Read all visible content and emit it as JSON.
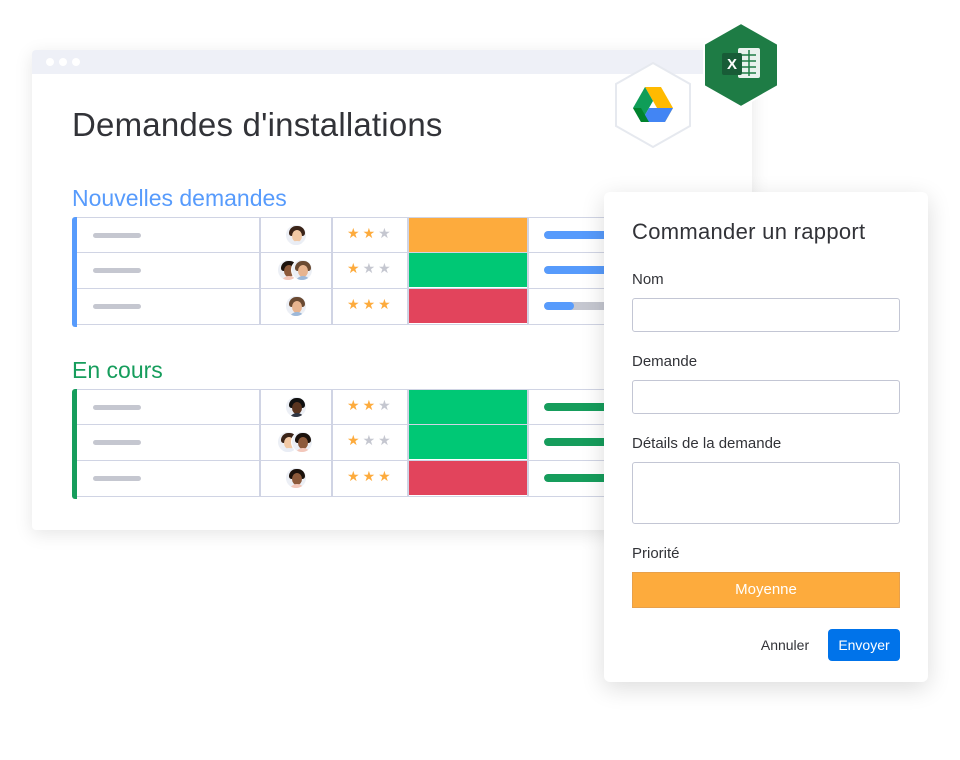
{
  "board": {
    "title": "Demandes d'installations",
    "groups": [
      {
        "title": "Nouvelles demandes",
        "color": "#579bfc",
        "rows": [
          {
            "people": 1,
            "rating": 2,
            "status_color": "#fdab3d",
            "progress": 0.75
          },
          {
            "people": 2,
            "rating": 1,
            "status_color": "#00c875",
            "progress": 0.6
          },
          {
            "people": 1,
            "rating": 3,
            "status_color": "#e2445c",
            "progress": 0.25
          }
        ]
      },
      {
        "title": "En cours",
        "color": "#169d5c",
        "rows": [
          {
            "people": 1,
            "rating": 2,
            "status_color": "#00c875",
            "progress": 0.8
          },
          {
            "people": 2,
            "rating": 1,
            "status_color": "#00c875",
            "progress": 0.7
          },
          {
            "people": 1,
            "rating": 3,
            "status_color": "#e2445c",
            "progress": 0.65
          }
        ]
      }
    ]
  },
  "integrations": {
    "icons": [
      "google-drive-icon",
      "excel-icon"
    ],
    "excel_letter": "X"
  },
  "form": {
    "title": "Commander un rapport",
    "fields": {
      "name_label": "Nom",
      "name_value": "",
      "request_label": "Demande",
      "request_value": "",
      "details_label": "Détails de la demande",
      "details_value": ""
    },
    "priority_label": "Priorité",
    "priority_value": "Moyenne",
    "priority_color": "#fdab3d",
    "cancel_label": "Annuler",
    "submit_label": "Envoyer",
    "submit_color": "#0073ea"
  }
}
